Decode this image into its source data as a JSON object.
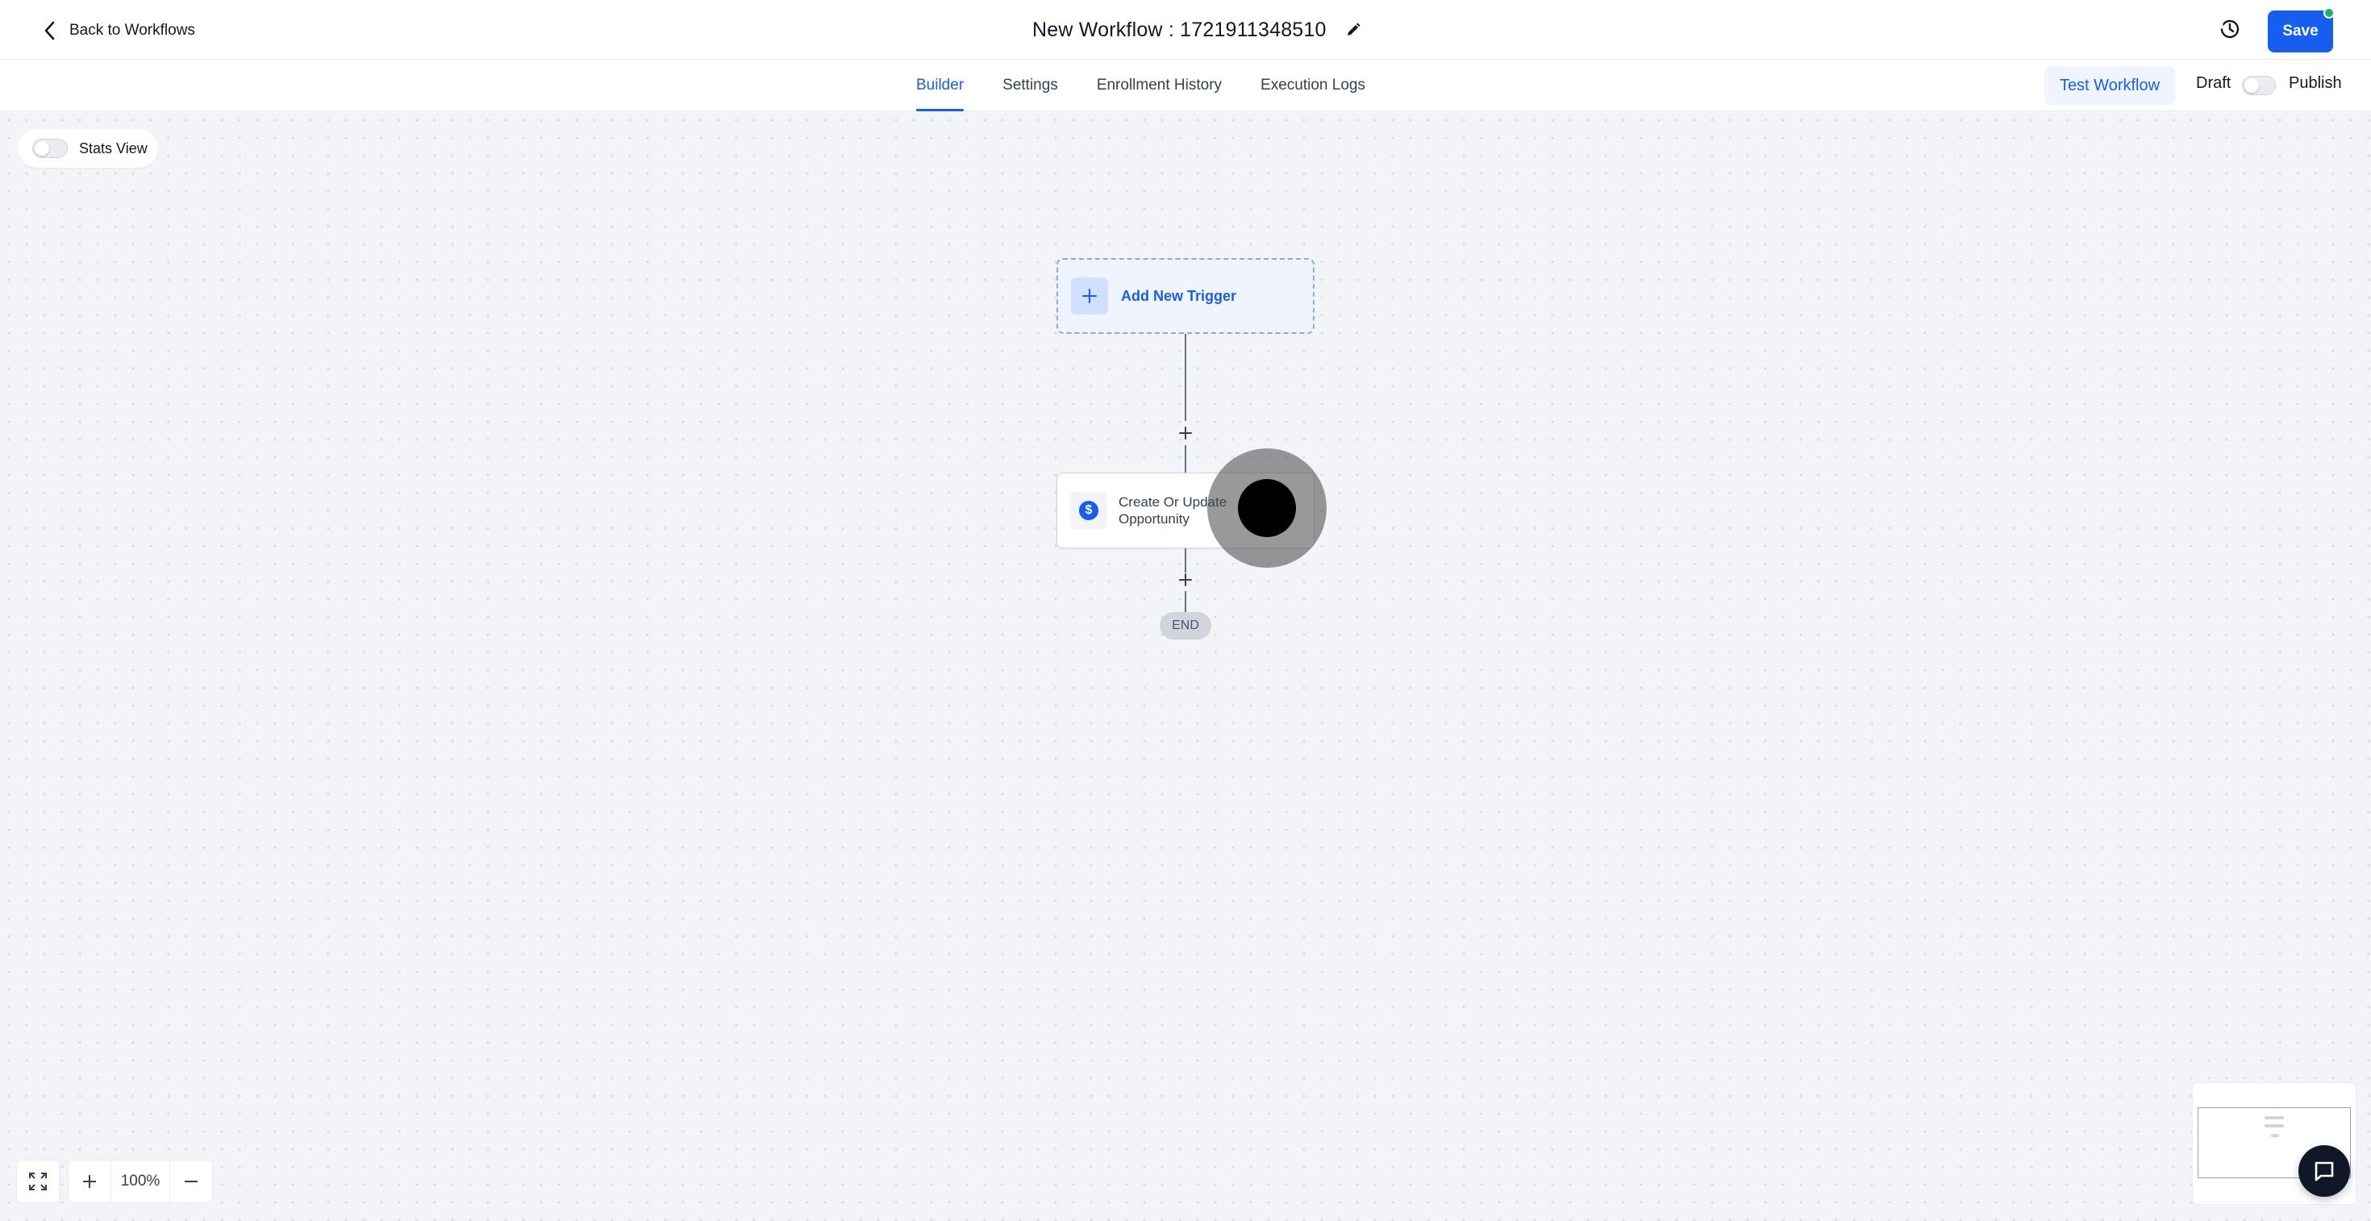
{
  "header": {
    "back_label": "Back to Workflows",
    "workflow_title": "New Workflow : 1721911348510",
    "save_label": "Save"
  },
  "tabs": [
    {
      "label": "Builder",
      "active": true
    },
    {
      "label": "Settings",
      "active": false
    },
    {
      "label": "Enrollment History",
      "active": false
    },
    {
      "label": "Execution Logs",
      "active": false
    }
  ],
  "actions": {
    "test_workflow_label": "Test Workflow",
    "draft_label": "Draft",
    "publish_label": "Publish",
    "publish_enabled": false
  },
  "canvas": {
    "stats_view_label": "Stats View",
    "stats_view_enabled": false,
    "trigger_label": "Add New Trigger",
    "action_label": "Create Or Update Opportunity",
    "action_icon": "dollar-icon",
    "end_label": "END"
  },
  "zoom": {
    "level": "100%"
  },
  "colors": {
    "accent": "#155eef",
    "status_dot": "#17b26a",
    "canvas_bg": "#f2f4f7"
  }
}
